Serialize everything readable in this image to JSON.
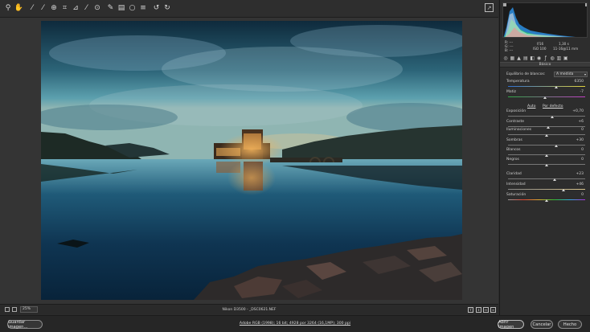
{
  "toolbar": {
    "tools": [
      {
        "icon": "zoom-icon",
        "glyph": "⚲"
      },
      {
        "icon": "hand-icon",
        "glyph": "✋"
      },
      {
        "icon": "white-balance-icon",
        "glyph": "⁄"
      },
      {
        "icon": "color-sampler-icon",
        "glyph": "⁄"
      },
      {
        "icon": "targeted-adjustment-icon",
        "glyph": "⊕"
      },
      {
        "icon": "crop-icon",
        "glyph": "⌗"
      },
      {
        "icon": "straighten-icon",
        "glyph": "⊿"
      },
      {
        "icon": "spot-removal-icon",
        "glyph": "⁄"
      },
      {
        "icon": "red-eye-icon",
        "glyph": "⊙"
      },
      {
        "icon": "adjustment-brush-icon",
        "glyph": "✎"
      },
      {
        "icon": "graduated-filter-icon",
        "glyph": "▤"
      },
      {
        "icon": "radial-filter-icon",
        "glyph": "○"
      },
      {
        "icon": "preferences-icon",
        "glyph": "≡"
      },
      {
        "icon": "rotate-left-icon",
        "glyph": "↺"
      },
      {
        "icon": "rotate-right-icon",
        "glyph": "↻"
      }
    ]
  },
  "exif": {
    "r": "R:",
    "g": "G:",
    "b": "B:",
    "dash": "---",
    "aperture": "f/16",
    "shutter": "1,30 s",
    "iso": "ISO 100",
    "lens": "11-16@11 mm"
  },
  "panel": {
    "title": "Básico",
    "wb_label": "Equilibrio de blancos:",
    "wb_value": "A medida",
    "auto": "Auto",
    "default": "Por defecto",
    "sliders": [
      {
        "label": "Temperatura",
        "value": "6350",
        "pos": 0.62
      },
      {
        "label": "Matiz",
        "value": "-7",
        "pos": 0.48
      },
      {
        "label": "Exposición",
        "value": "+0,70",
        "pos": 0.57
      },
      {
        "label": "Contraste",
        "value": "+6",
        "pos": 0.52
      },
      {
        "label": "Iluminaciones",
        "value": "0",
        "pos": 0.5
      },
      {
        "label": "Sombras",
        "value": "+30",
        "pos": 0.62
      },
      {
        "label": "Blancos",
        "value": "0",
        "pos": 0.5
      },
      {
        "label": "Negros",
        "value": "0",
        "pos": 0.5
      },
      {
        "label": "Claridad",
        "value": "+23",
        "pos": 0.6
      },
      {
        "label": "Intensidad",
        "value": "+46",
        "pos": 0.72
      },
      {
        "label": "Saturación",
        "value": "0",
        "pos": 0.5
      }
    ]
  },
  "status": {
    "zoom": "25%",
    "filename": "Nikon D3500 - _DSC0621.NEF"
  },
  "bottom": {
    "save": "Guardar imagen...",
    "workflow": "Adobe RGB (1998); 16 bit; 4928 por 3264 (16,1MP); 300 ppi",
    "open": "Abrir imagen",
    "cancel": "Cancelar",
    "done": "Hecho"
  },
  "colors": {
    "accent": "#5d8dd0",
    "temperature_track": [
      "#2d6fd3",
      "#e4d43a"
    ],
    "tint_track": [
      "#2ea845",
      "#c43fc7"
    ]
  }
}
